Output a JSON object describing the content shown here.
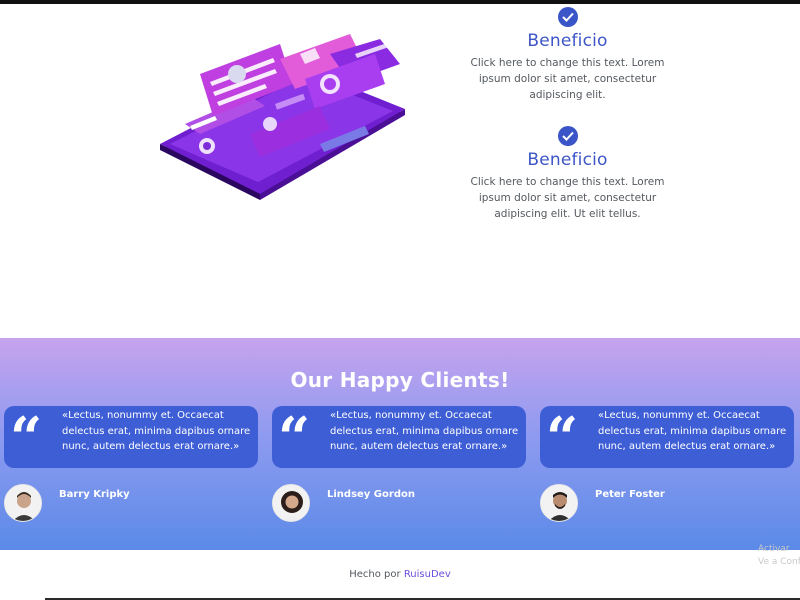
{
  "benefits": [
    {
      "title": "Beneficio",
      "text": "Click here to change this text. Lorem ipsum dolor sit amet, consectetur adipiscing elit."
    },
    {
      "title": "Beneficio",
      "text": "Click here to change this text. Lorem ipsum dolor sit amet, consectetur adipiscing elit. Ut elit tellus."
    }
  ],
  "clients": {
    "title": "Our Happy Clients!",
    "quote_glyph": "“",
    "testimonials": [
      {
        "quote": "«Lectus, nonummy et. Occaecat delectus erat, minima dapibus ornare nunc, autem delectus erat ornare.»",
        "name": "Barry Kripky"
      },
      {
        "quote": "«Lectus, nonummy et. Occaecat delectus erat, minima dapibus ornare nunc, autem delectus erat ornare.»",
        "name": "Lindsey Gordon"
      },
      {
        "quote": "«Lectus, nonummy et. Occaecat delectus erat, minima dapibus ornare nunc, autem delectus erat ornare.»",
        "name": "Peter Foster"
      }
    ]
  },
  "footer": {
    "prefix": "Hecho por",
    "link": "RuisuDev",
    "overlay_line1": "Activar",
    "overlay_line2": "Ve a Config"
  },
  "colors": {
    "accent": "#3d55c6",
    "bubble": "#3e5ed6",
    "gradient_top": "#c7a3ee",
    "gradient_bottom": "#5b8ae8",
    "link": "#6c4ed8"
  },
  "icons": {
    "benefit": "check-circle-icon",
    "testimonial": "quote-icon",
    "illustration": "phone-chat-illustration"
  }
}
